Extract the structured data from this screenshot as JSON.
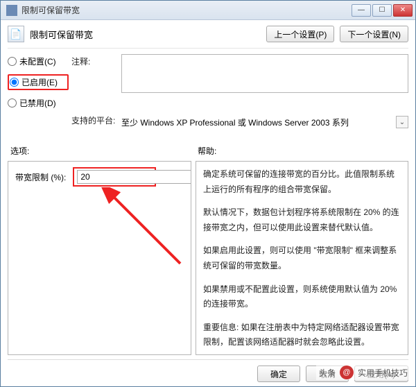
{
  "window": {
    "title": "限制可保留带宽"
  },
  "header": {
    "title": "限制可保留带宽",
    "prev": "上一个设置(P)",
    "next": "下一个设置(N)"
  },
  "config": {
    "not_configured": "未配置(C)",
    "enabled": "已启用(E)",
    "disabled": "已禁用(D)",
    "selected": "enabled"
  },
  "comment": {
    "label": "注释:",
    "value": ""
  },
  "platform": {
    "label": "支持的平台:",
    "value": "至少 Windows XP Professional 或 Windows Server 2003 系列"
  },
  "sections": {
    "options": "选项:",
    "help": "帮助:"
  },
  "option": {
    "label": "带宽限制 (%):",
    "value": "20"
  },
  "help": {
    "p1": "确定系统可保留的连接带宽的百分比。此值限制系统上运行的所有程序的组合带宽保留。",
    "p2": "默认情况下，数据包计划程序将系统限制在 20% 的连接带宽之内，但可以使用此设置来替代默认值。",
    "p3": "如果启用此设置，则可以使用 \"带宽限制\" 框来调整系统可保留的带宽数量。",
    "p4": "如果禁用或不配置此设置，则系统使用默认值为 20% 的连接带宽。",
    "p5": "重要信息: 如果在注册表中为特定网络适配器设置带宽限制，配置该网络适配器时就会忽略此设置。"
  },
  "footer": {
    "ok": "确定",
    "cancel": "取消",
    "apply": "应用(A)"
  },
  "watermark": {
    "prefix": "头条",
    "name": "实用手机技巧"
  }
}
